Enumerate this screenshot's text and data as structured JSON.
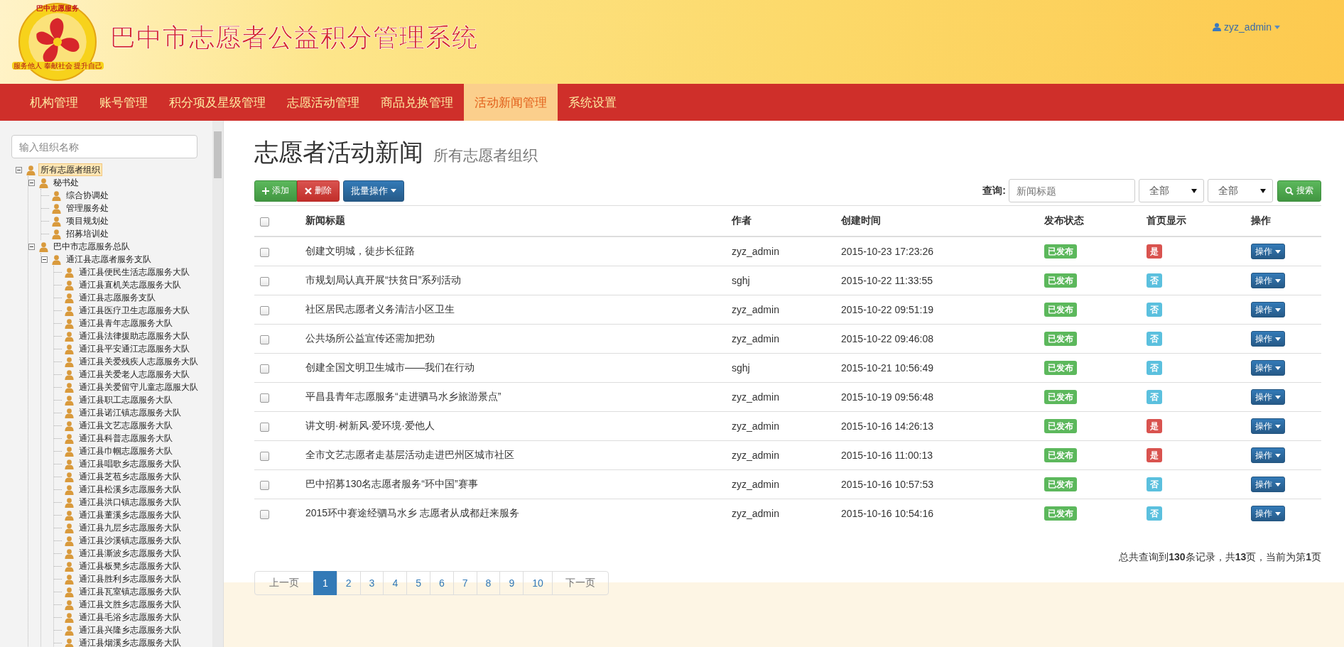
{
  "header": {
    "logo_caption": "巴中志愿服务",
    "logo_motto": "服务他人 奉献社会 提升自己",
    "title": "巴中市志愿者公益积分管理系统",
    "user": "zyz_admin"
  },
  "nav": [
    {
      "label": "机构管理",
      "selected": false
    },
    {
      "label": "账号管理",
      "selected": false
    },
    {
      "label": "积分项及星级管理",
      "selected": false
    },
    {
      "label": "志愿活动管理",
      "selected": false
    },
    {
      "label": "商品兑换管理",
      "selected": false
    },
    {
      "label": "活动新闻管理",
      "selected": true
    },
    {
      "label": "系统设置",
      "selected": false
    }
  ],
  "sidebar": {
    "search": {
      "placeholder": "输入组织名称"
    },
    "tree": [
      {
        "label": "所有志愿者组织",
        "selected": true,
        "expanded": true,
        "children": [
          {
            "label": "秘书处",
            "selected": false,
            "expanded": true,
            "children": [
              {
                "label": "综合协调处",
                "selected": false
              },
              {
                "label": "管理服务处",
                "selected": false
              },
              {
                "label": "项目规划处",
                "selected": false
              },
              {
                "label": "招募培训处",
                "selected": false
              }
            ]
          },
          {
            "label": "巴中市志愿服务总队",
            "selected": false,
            "expanded": true,
            "children": [
              {
                "label": "通江县志愿者服务支队",
                "selected": false,
                "expanded": true,
                "children": [
                  {
                    "label": "通江县便民生活志愿服务大队",
                    "selected": false
                  },
                  {
                    "label": "通江县直机关志愿服务大队",
                    "selected": false
                  },
                  {
                    "label": "通江县志愿服务支队",
                    "selected": false
                  },
                  {
                    "label": "通江县医疗卫生志愿服务大队",
                    "selected": false
                  },
                  {
                    "label": "通江县青年志愿服务大队",
                    "selected": false
                  },
                  {
                    "label": "通江县法律援助志愿服务大队",
                    "selected": false
                  },
                  {
                    "label": "通江县平安通江志愿服务大队",
                    "selected": false
                  },
                  {
                    "label": "通江县关爱残疾人志愿服务大队",
                    "selected": false
                  },
                  {
                    "label": "通江县关爱老人志愿服务大队",
                    "selected": false
                  },
                  {
                    "label": "通江县关爱留守儿童志愿服大队",
                    "selected": false
                  },
                  {
                    "label": "通江县职工志愿服务大队",
                    "selected": false
                  },
                  {
                    "label": "通江县诺江镇志愿服务大队",
                    "selected": false
                  },
                  {
                    "label": "通江县文艺志愿服务大队",
                    "selected": false
                  },
                  {
                    "label": "通江县科普志愿服务大队",
                    "selected": false
                  },
                  {
                    "label": "通江县巾帼志愿服务大队",
                    "selected": false
                  },
                  {
                    "label": "通江县唱歌乡志愿服务大队",
                    "selected": false
                  },
                  {
                    "label": "通江县芝苞乡志愿服务大队",
                    "selected": false
                  },
                  {
                    "label": "通江县松溪乡志愿服务大队",
                    "selected": false
                  },
                  {
                    "label": "通江县洪口镇志愿服务大队",
                    "selected": false
                  },
                  {
                    "label": "通江县董溪乡志愿服务大队",
                    "selected": false
                  },
                  {
                    "label": "通江县九层乡志愿服务大队",
                    "selected": false
                  },
                  {
                    "label": "通江县沙溪镇志愿服务大队",
                    "selected": false
                  },
                  {
                    "label": "通江县澌波乡志愿服务大队",
                    "selected": false
                  },
                  {
                    "label": "通江县板凳乡志愿服务大队",
                    "selected": false
                  },
                  {
                    "label": "通江县胜利乡志愿服务大队",
                    "selected": false
                  },
                  {
                    "label": "通江县瓦室镇志愿服务大队",
                    "selected": false
                  },
                  {
                    "label": "通江县文胜乡志愿服务大队",
                    "selected": false
                  },
                  {
                    "label": "通江县毛浴乡志愿服务大队",
                    "selected": false
                  },
                  {
                    "label": "通江县兴隆乡志愿服务大队",
                    "selected": false
                  },
                  {
                    "label": "通江县烟溪乡志愿服务大队",
                    "selected": false
                  }
                ]
              }
            ]
          }
        ]
      }
    ]
  },
  "page": {
    "title": "志愿者活动新闻",
    "subtitle": "所有志愿者组织"
  },
  "toolbar": {
    "add": "添加",
    "delete": "删除",
    "batch": "批量操作",
    "query_label": "查询:",
    "search": {
      "placeholder": "新闻标题"
    },
    "filters": [
      "全部",
      "全部"
    ],
    "search_button": "搜索"
  },
  "table": {
    "select_all_checked": false,
    "columns": [
      "新闻标题",
      "作者",
      "创建时间",
      "发布状态",
      "首页显示",
      "操作"
    ],
    "rows": [
      {
        "checked": false,
        "title": "创建文明城，徒步长征路",
        "author": "zyz_admin",
        "created": "2015-10-23 17:23:26",
        "status": "已发布",
        "homepage": "是",
        "on_homepage": true,
        "action": "操作"
      },
      {
        "checked": false,
        "title": "市规划局认真开展“扶贫日”系列活动",
        "author": "sghj",
        "created": "2015-10-22 11:33:55",
        "status": "已发布",
        "homepage": "否",
        "on_homepage": false,
        "action": "操作"
      },
      {
        "checked": false,
        "title": "社区居民志愿者义务清洁小区卫生",
        "author": "zyz_admin",
        "created": "2015-10-22 09:51:19",
        "status": "已发布",
        "homepage": "否",
        "on_homepage": false,
        "action": "操作"
      },
      {
        "checked": false,
        "title": "公共场所公益宣传还需加把劲",
        "author": "zyz_admin",
        "created": "2015-10-22 09:46:08",
        "status": "已发布",
        "homepage": "否",
        "on_homepage": false,
        "action": "操作"
      },
      {
        "checked": false,
        "title": "创建全国文明卫生城市——我们在行动",
        "author": "sghj",
        "created": "2015-10-21 10:56:49",
        "status": "已发布",
        "homepage": "否",
        "on_homepage": false,
        "action": "操作"
      },
      {
        "checked": false,
        "title": "平昌县青年志愿服务“走进驷马水乡旅游景点”",
        "author": "zyz_admin",
        "created": "2015-10-19 09:56:48",
        "status": "已发布",
        "homepage": "否",
        "on_homepage": false,
        "action": "操作"
      },
      {
        "checked": false,
        "title": "讲文明·树新风·爱环境·爱他人",
        "author": "zyz_admin",
        "created": "2015-10-16 14:26:13",
        "status": "已发布",
        "homepage": "是",
        "on_homepage": true,
        "action": "操作"
      },
      {
        "checked": false,
        "title": "全市文艺志愿者走基层活动走进巴州区城市社区",
        "author": "zyz_admin",
        "created": "2015-10-16 11:00:13",
        "status": "已发布",
        "homepage": "是",
        "on_homepage": true,
        "action": "操作"
      },
      {
        "checked": false,
        "title": "巴中招募130名志愿者服务“环中国”赛事",
        "author": "zyz_admin",
        "created": "2015-10-16 10:57:53",
        "status": "已发布",
        "homepage": "否",
        "on_homepage": false,
        "action": "操作"
      },
      {
        "checked": false,
        "title": "2015环中赛途经驷马水乡 志愿者从成都赶来服务",
        "author": "zyz_admin",
        "created": "2015-10-16 10:54:16",
        "status": "已发布",
        "homepage": "否",
        "on_homepage": false,
        "action": "操作"
      }
    ]
  },
  "summary": "总共查询到**130**条记录，共**13**页，当前为第**1**页",
  "pagination": {
    "prev": "上一页",
    "next": "下一页",
    "pages": [
      {
        "label": "1",
        "selected": true
      },
      {
        "label": "2",
        "selected": false
      },
      {
        "label": "3",
        "selected": false
      },
      {
        "label": "4",
        "selected": false
      },
      {
        "label": "5",
        "selected": false
      },
      {
        "label": "6",
        "selected": false
      },
      {
        "label": "7",
        "selected": false
      },
      {
        "label": "8",
        "selected": false
      },
      {
        "label": "9",
        "selected": false
      },
      {
        "label": "10",
        "selected": false
      }
    ]
  }
}
